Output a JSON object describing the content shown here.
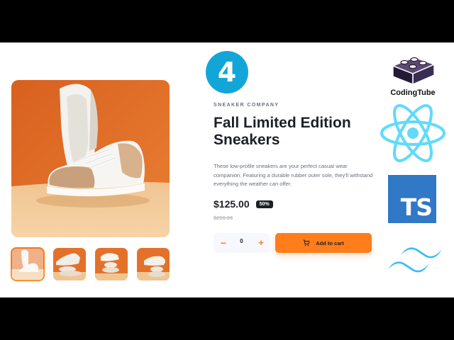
{
  "episode": {
    "number": "4"
  },
  "product": {
    "company": "SNEAKER COMPANY",
    "title": "Fall Limited Edition Sneakers",
    "description": "These low-profile sneakers are your perfect casual wear companion. Featuring a durable rubber outer sole, they'll withstand everything the weather can offer.",
    "price": "$125.00",
    "discount": "50%",
    "old_price": "$250.00"
  },
  "cart": {
    "quantity": "0",
    "minus_symbol": "−",
    "plus_symbol": "+",
    "add_label": "Add to cart"
  },
  "gallery": {
    "thumbnails": [
      "thumbnail-1",
      "thumbnail-2",
      "thumbnail-3",
      "thumbnail-4"
    ],
    "active_index": 0
  },
  "branding": {
    "channel_name": "CodingTube",
    "ts_text": "TS",
    "logos": [
      "codingtube-logo",
      "react-logo",
      "typescript-logo",
      "tailwind-logo"
    ]
  },
  "colors": {
    "accent": "#ff7d1a",
    "dark": "#1d2026",
    "badge_blue": "#12a6d8",
    "react": "#61dafb",
    "typescript": "#3178c6",
    "tailwind": "#38bdf8",
    "image_orange": "#e37129",
    "image_sand": "#f0c592"
  }
}
